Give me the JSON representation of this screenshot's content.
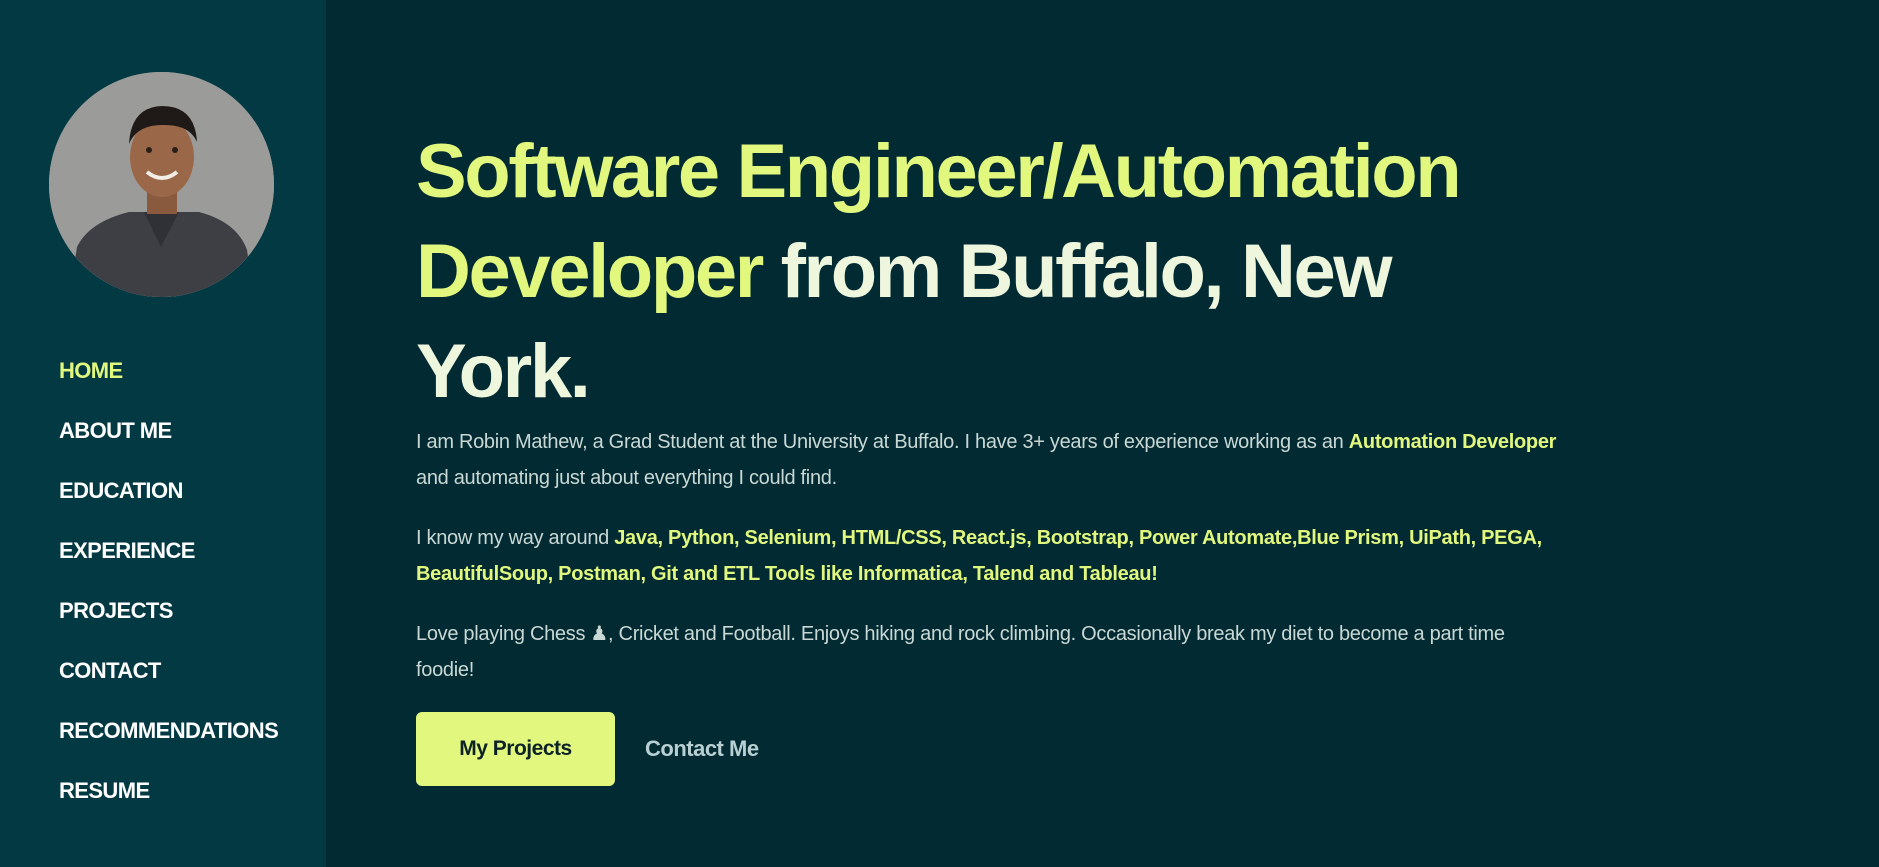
{
  "colors": {
    "background": "#022a32",
    "sidebar_background": "#033943",
    "accent": "#e1f77e",
    "headline_text": "#eef6dd",
    "body_text": "#c9d8d4"
  },
  "sidebar": {
    "avatar_icon": "profile-photo",
    "nav": [
      {
        "label": "HOME",
        "active": true
      },
      {
        "label": "ABOUT ME"
      },
      {
        "label": "EDUCATION"
      },
      {
        "label": "EXPERIENCE"
      },
      {
        "label": "PROJECTS"
      },
      {
        "label": "CONTACT"
      },
      {
        "label": "RECOMMENDATIONS"
      },
      {
        "label": "RESUME"
      }
    ]
  },
  "hero": {
    "headline_highlight": "Software Engineer/Automation Developer",
    "headline_rest": " from Buffalo, New York.",
    "intro": {
      "before": "I am Robin Mathew, a Grad Student at the University at Buffalo. I have 3+ years of experience working as an ",
      "highlight": "Automation Developer",
      "after": " and automating just about everything I could find."
    },
    "skills": {
      "before": "I know my way around ",
      "highlight": "Java, Python, Selenium, HTML/CSS, React.js, Bootstrap, Power Automate,Blue Prism, UiPath, PEGA, BeautifulSoup, Postman, Git and ETL Tools like Informatica, Talend and Tableau!"
    },
    "hobbies": "Love playing Chess ♟, Cricket and Football. Enjoys hiking and rock climbing. Occasionally break my diet to become a part time foodie!",
    "primary_button": "My Projects",
    "secondary_link": "Contact Me"
  }
}
